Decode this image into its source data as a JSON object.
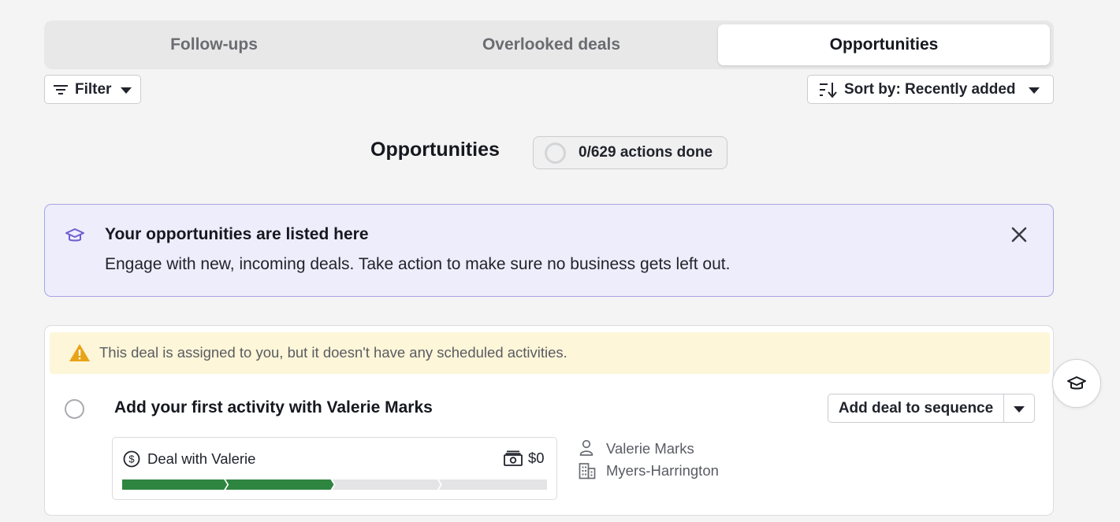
{
  "tabs": [
    {
      "label": "Follow-ups"
    },
    {
      "label": "Overlooked deals"
    },
    {
      "label": "Opportunities",
      "active": true
    }
  ],
  "toolbar": {
    "filter_label": "Filter",
    "sort_label": "Sort by: Recently added"
  },
  "section": {
    "title": "Opportunities",
    "progress_text": "0/629 actions done",
    "actions_done": 0,
    "actions_total": 629
  },
  "info_banner": {
    "title": "Your opportunities are listed here",
    "text": "Engage with new, incoming deals. Take action to make sure no business gets left out.",
    "accent": "#6b5fd1"
  },
  "deal_card": {
    "warning_text": "This deal is assigned to you, but it doesn't have any scheduled activities.",
    "warning_color": "#e8a317",
    "title": "Add your first activity with Valerie Marks",
    "sequence_button": "Add deal to sequence",
    "deal": {
      "name": "Deal with Valerie",
      "value": "$0",
      "pipeline_stages_total": 4,
      "pipeline_stages_done": 2,
      "stage_done_color": "#2e8540",
      "stage_todo_color": "#e4e4e6"
    },
    "person": "Valerie Marks",
    "organization": "Myers-Harrington"
  },
  "icons": {
    "filter": "filter-icon",
    "sort": "sort-icon",
    "info": "graduation-cap-icon",
    "close": "close-icon",
    "warning": "warning-icon",
    "dollar": "dollar-circle-icon",
    "money": "money-icon",
    "person": "person-icon",
    "organization": "building-icon",
    "help": "graduation-cap-icon"
  }
}
